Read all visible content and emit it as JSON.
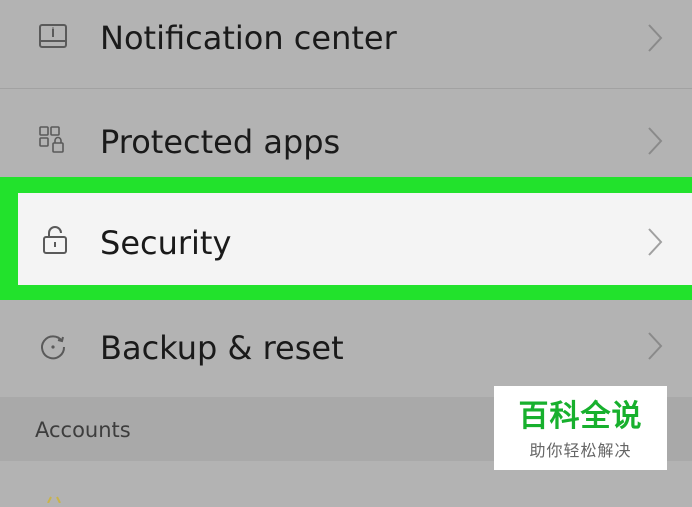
{
  "settings_list": {
    "items": [
      {
        "label": "Notification center",
        "icon": "notification-center-icon"
      },
      {
        "label": "Protected apps",
        "icon": "protected-apps-icon"
      },
      {
        "label": "Security",
        "icon": "lock-icon",
        "highlighted": true
      },
      {
        "label": "Backup & reset",
        "icon": "backup-reset-icon"
      }
    ]
  },
  "section": {
    "accounts_label": "Accounts"
  },
  "watermark": {
    "title": "百科全说",
    "subtitle": "助你轻松解决"
  },
  "colors": {
    "highlight": "#22e22c",
    "dimmed_background": "#b3b3b3",
    "selected_row_background": "#f4f4f4",
    "watermark_title": "#17b02d"
  }
}
